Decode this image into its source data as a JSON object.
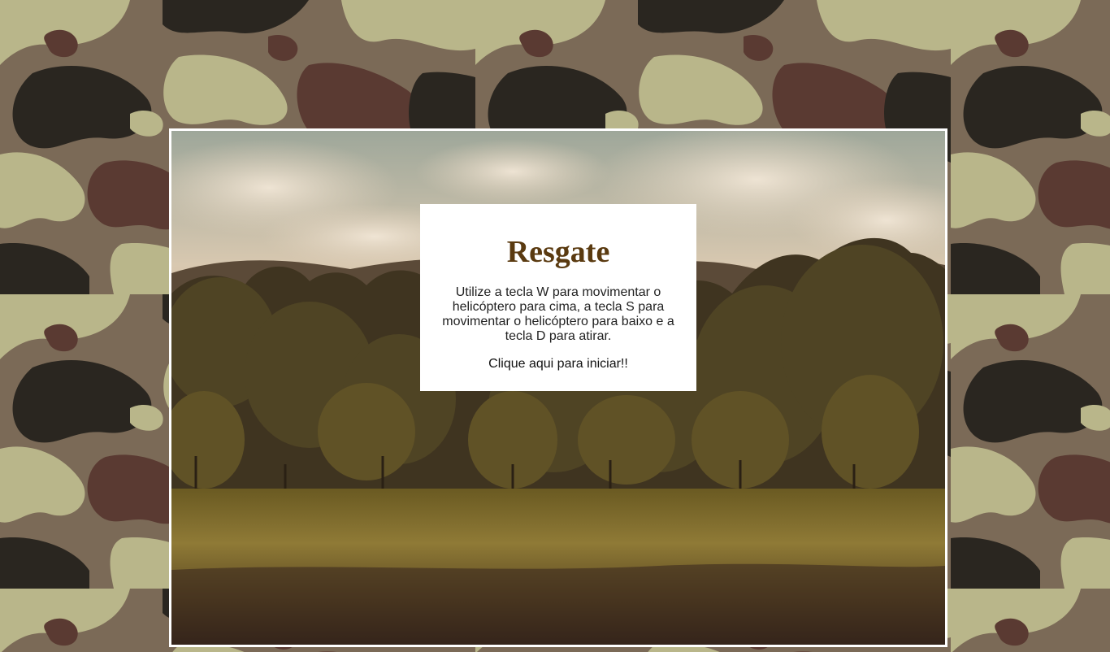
{
  "game": {
    "title": "Resgate",
    "instructions": "Utilize a tecla W para movimentar o helicóptero para cima, a tecla S para movimentar o helicóptero para baixo e a tecla D para atirar.",
    "start_label": "Clique aqui para iniciar!!"
  },
  "colors": {
    "title": "#5a3a10",
    "camo_light": "#b9b68a",
    "camo_mid": "#7b6a57",
    "camo_brown": "#5a3a32",
    "camo_dark": "#2a2620",
    "frame_border": "#ffffff",
    "panel_background": "#ffffff"
  },
  "icons": {
    "background": "camouflage-pattern",
    "scene": "forest-landscape"
  }
}
